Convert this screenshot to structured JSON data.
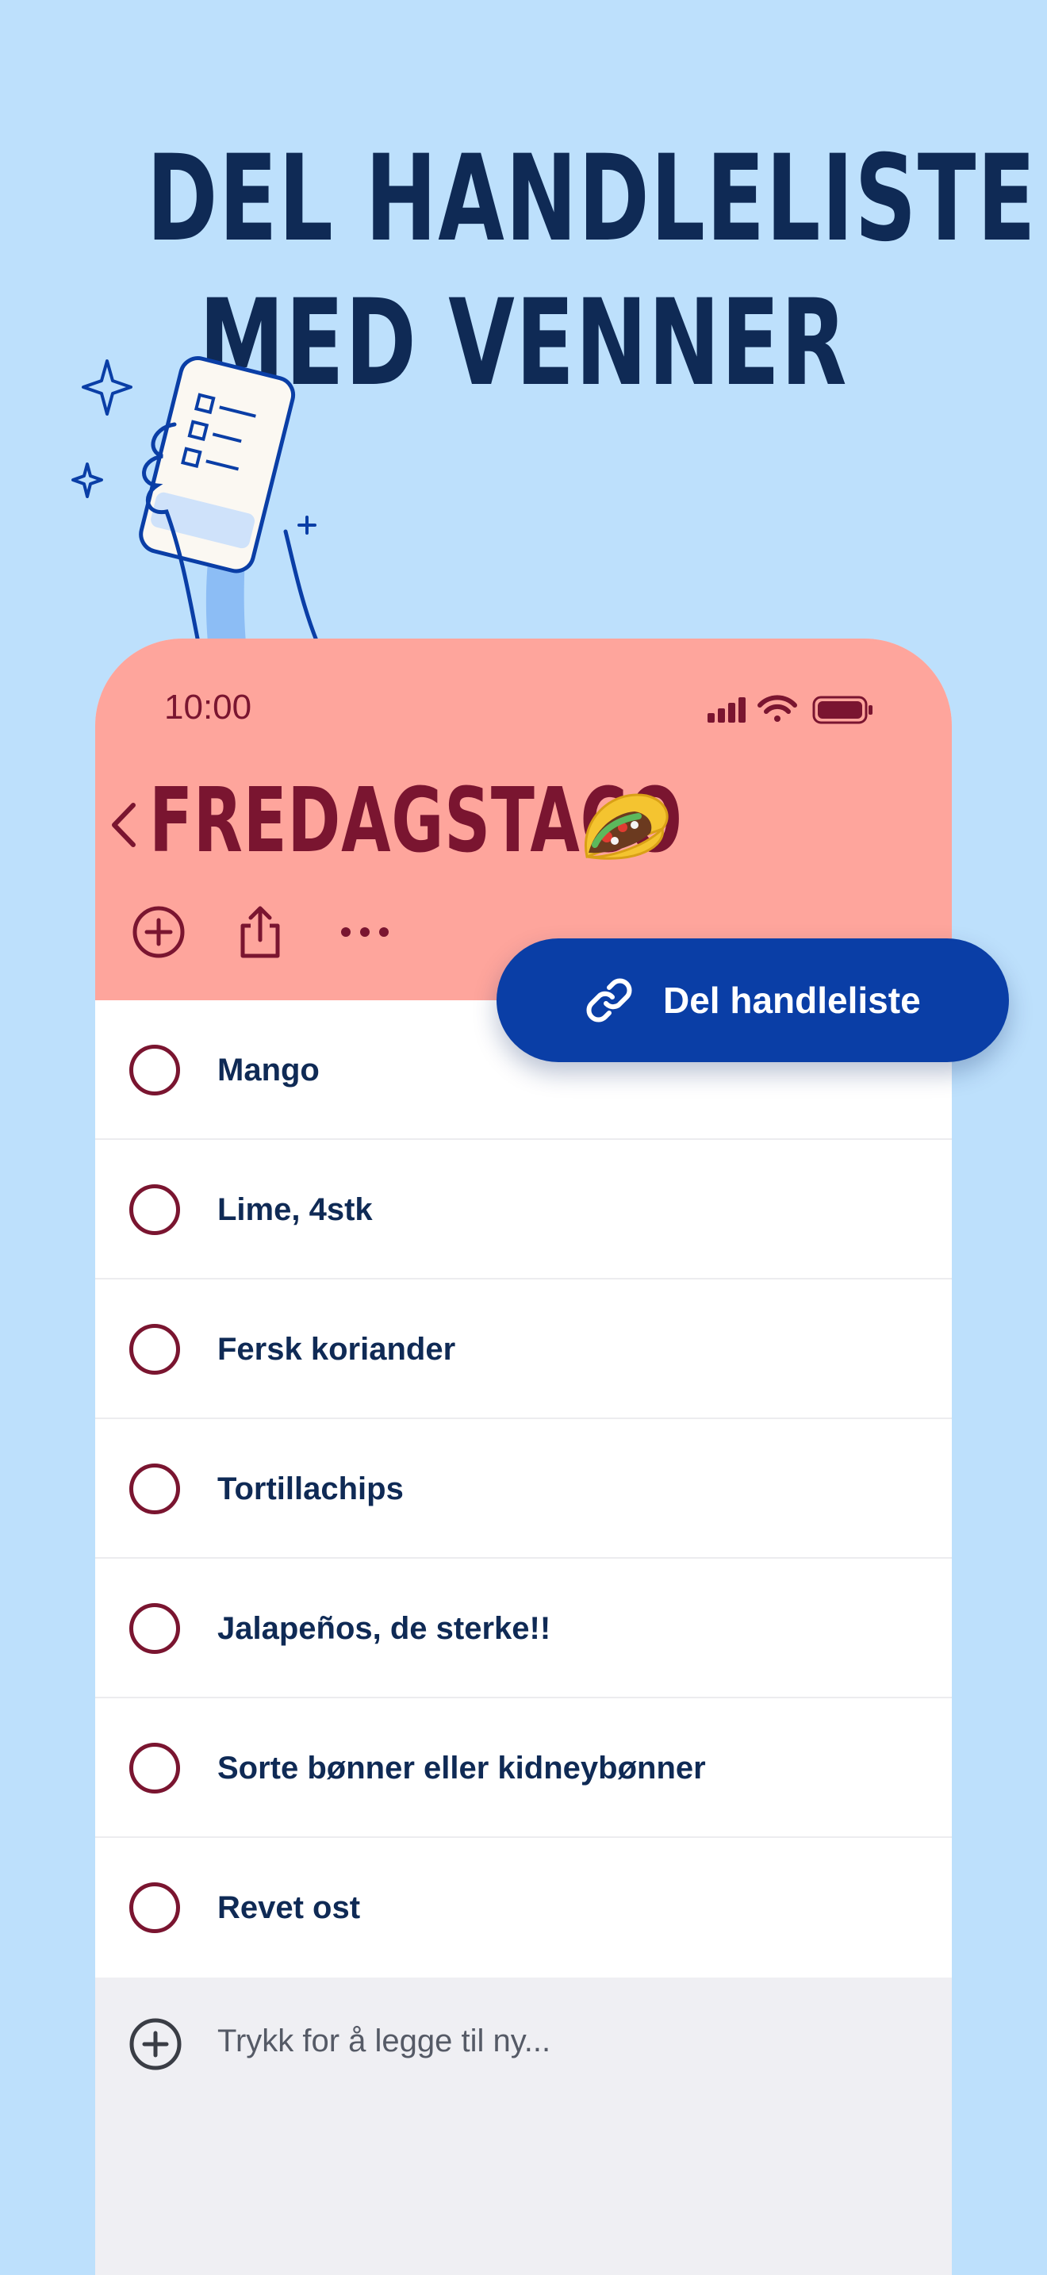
{
  "headline": {
    "line1": "DEL HANDLELISTE",
    "line2": "MED VENNER"
  },
  "status_bar": {
    "time": "10:00"
  },
  "list": {
    "title": "FREDAGSTACO",
    "title_emoji_icon": "taco-icon",
    "items": [
      {
        "label": "Mango"
      },
      {
        "label": "Lime, 4stk"
      },
      {
        "label": "Fersk koriander"
      },
      {
        "label": "Tortillachips"
      },
      {
        "label": "Jalapeños, de sterke!!"
      },
      {
        "label": "Sorte bønner eller kidneybønner"
      },
      {
        "label": "Revet ost"
      }
    ],
    "add_placeholder": "Trykk for å legge til ny..."
  },
  "share_button": {
    "label": "Del handleliste",
    "icon": "link-icon"
  },
  "toolbar": {
    "icons": [
      "add-circle-icon",
      "share-icon",
      "more-icon"
    ]
  },
  "colors": {
    "background": "#bde0fc",
    "headline": "#0f2a55",
    "header": "#fea59c",
    "accent_dark_red": "#7a1530",
    "share_button": "#0a3ea6"
  }
}
